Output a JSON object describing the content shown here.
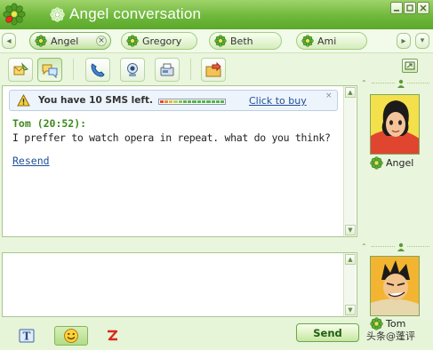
{
  "window": {
    "title": "Angel conversation",
    "minimize_glyph": "▁",
    "maximize_glyph": "□",
    "close_glyph": "×"
  },
  "tabs": [
    {
      "label": "Angel",
      "active": true,
      "close_glyph": "×"
    },
    {
      "label": "Gregory",
      "active": false
    },
    {
      "label": "Beth",
      "active": false
    },
    {
      "label": "Ami",
      "active": false
    }
  ],
  "tab_scroll": {
    "left_glyph": "◂",
    "right_glyph": "▸"
  },
  "toolbar": {
    "icons": [
      "message-icon",
      "chat-mode-icon",
      "phone-icon",
      "webcam-icon",
      "fax-icon",
      "send-file-icon"
    ]
  },
  "sms_notice": {
    "text": "You have 10 SMS left.",
    "link": "Click to buy",
    "close_glyph": "×",
    "meter_colors": [
      "#e24a33",
      "#ee8a2a",
      "#f3b531",
      "#b6d35a",
      "#80c65a",
      "#57b24b",
      "#57b24b",
      "#57b24b",
      "#57b24b",
      "#57b24b",
      "#57b24b",
      "#57b24b",
      "#57b24b",
      "#57b24b"
    ]
  },
  "message": {
    "header": "Tom (20:52):",
    "body": "I preffer to watch opera in repeat. what do you think?",
    "resend": "Resend"
  },
  "scroll": {
    "up_glyph": "▲",
    "down_glyph": "▼"
  },
  "contacts": {
    "remote": {
      "name": "Angel"
    },
    "local": {
      "name": "Tom"
    },
    "collapse_glyph": "⌃"
  },
  "bottom": {
    "send_label": "Send",
    "watermark": "头条@蓬评"
  },
  "colors": {
    "titlebar": "#6fb83b",
    "accent_green": "#3d8a1f",
    "link_blue": "#1f4f9a"
  }
}
